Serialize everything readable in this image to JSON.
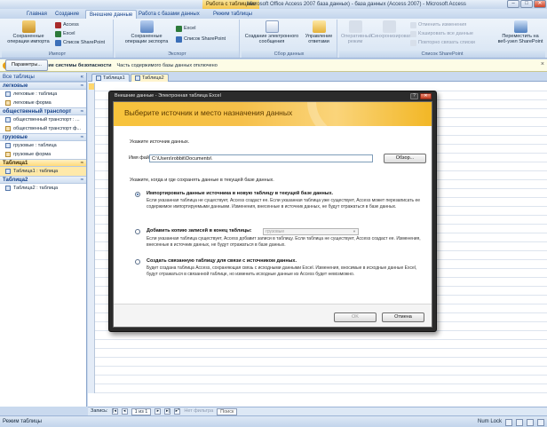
{
  "titlebar": {
    "context": "Работа с таблицами",
    "title": "Microsoft Office Access 2007 база данных) - база данных (Access 2007) - Microsoft Access",
    "min": "–",
    "max": "□",
    "close": "✕"
  },
  "tabs": [
    "Главная",
    "Создание",
    "Внешние данные",
    "Работа с базами данных",
    "Режим таблицы"
  ],
  "ribbon": {
    "import": {
      "label": "Импорт",
      "saved_ops": "Сохраненные операции импорта",
      "access": "Access",
      "excel": "Excel",
      "sharepoint": "Список SharePoint"
    },
    "export": {
      "label": "Экспорт",
      "saved_ops": "Сохраненные операции экспорта",
      "excel": "Excel",
      "sharepoint": "Список SharePoint"
    },
    "collect": {
      "label": "Сбор данных",
      "create_email": "Создание электронного сообщения",
      "manage_replies": "Управление ответами"
    },
    "sharepoint_list": {
      "label": "Список SharePoint",
      "offline": "Оперативный режим",
      "sync": "Синхронизировать",
      "discard_changes": "Отменить изменения",
      "cache_all": "Кэшировать все данные",
      "relink": "Повторно связать списки",
      "move": "Переместить на веб-узел SharePoint"
    }
  },
  "security": {
    "title": "Предупреждение системы безопасности",
    "message": "Часть содержимого базы данных отключено",
    "button": "Параметры..."
  },
  "nav": {
    "header": "Все таблицы",
    "groups": [
      {
        "name": "легковые",
        "items": [
          {
            "label": "легковые : таблица",
            "type": "table"
          },
          {
            "label": "легковые форма",
            "type": "form"
          }
        ]
      },
      {
        "name": "общественный транспорт",
        "items": [
          {
            "label": "общественный транспорт : ...",
            "type": "table"
          },
          {
            "label": "общественный транспорт ф...",
            "type": "form"
          }
        ]
      },
      {
        "name": "грузовые",
        "items": [
          {
            "label": "грузовые : таблица",
            "type": "table"
          },
          {
            "label": "грузовые форма",
            "type": "form"
          }
        ]
      },
      {
        "name": "Таблица1",
        "items": [
          {
            "label": "Таблица1 : таблица",
            "type": "table"
          }
        ]
      },
      {
        "name": "Таблица2",
        "items": [
          {
            "label": "Таблица2 : таблица",
            "type": "table"
          }
        ]
      }
    ]
  },
  "doc": {
    "tabs": [
      "Таблица1",
      "Таблица2"
    ]
  },
  "recnav": {
    "label": "Запись:",
    "position": "1 из 1",
    "filter": "Нет фильтра",
    "search": "Поиск"
  },
  "status": {
    "mode": "Режим таблицы",
    "numlock": "Num Lock"
  },
  "dialog": {
    "title": "Внешние данные - Электронная таблица Excel",
    "help": "?",
    "close": "✕",
    "heading": "Выберите источник и место назначения данных",
    "source_label": "Укажите источник данных.",
    "file_label": "Имя файла:",
    "file_value": "C:\\Users\\robbit\\Documents\\",
    "browse": "Обзор...",
    "how_label": "Укажите, когда и где сохранять данные в текущей базе данных.",
    "options": [
      {
        "title": "Импортировать данные источника в новую таблицу в текущей базе данных.",
        "desc": "Если указанная таблица не существует, Access создаст ее. Если указанная таблица уже существует, Access может перезаписать ее содержимое импортируемыми данными. Изменения, внесенные в источник данных, не будут отражаться в базе данных.",
        "selected": true
      },
      {
        "title": "Добавить копию записей в конец таблицы:",
        "desc": "Если указанная таблица существует, Access добавит записи в таблицу. Если таблица не существует, Access создаст ее. Изменения, внесенные в источник данных, не будут отражаться в базе данных.",
        "combo": "грузовые",
        "selected": false
      },
      {
        "title": "Создать связанную таблицу для связи с источником данных.",
        "desc": "Будет создана таблица Access, сохраняющая связь с исходными данными Excel. Изменения, вносимые в исходные данные Excel, будут отражаться в связанной таблице, но изменить исходные данные из Access будет невозможно.",
        "selected": false
      }
    ],
    "ok": "OK",
    "cancel": "Отмена"
  }
}
